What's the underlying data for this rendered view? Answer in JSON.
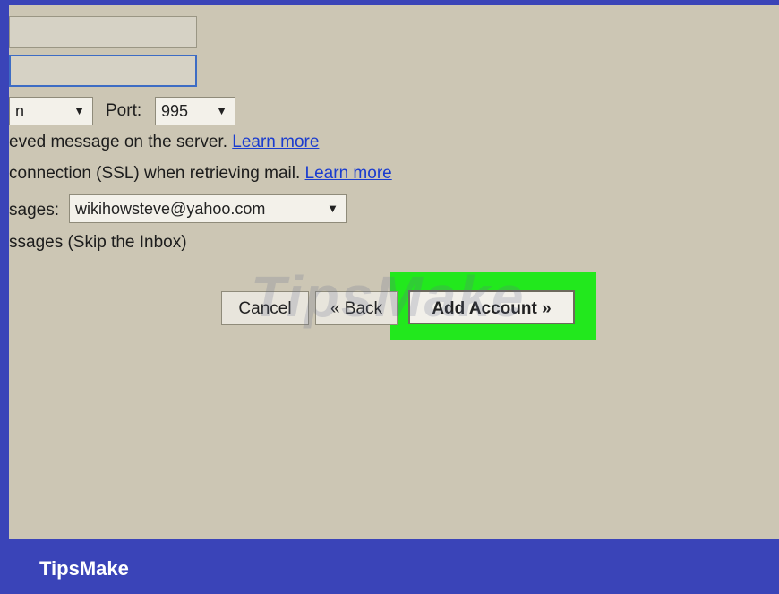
{
  "dialog": {
    "port_label": "Port:",
    "server_select_value": "n",
    "port_select_value": "995",
    "leave_copy_text": "eved message on the server.",
    "ssl_text": "connection (SSL) when retrieving mail.",
    "learn_more": "Learn more",
    "label_as_text": "sages:",
    "label_as_value": "wikihowsteve@yahoo.com",
    "archive_text": "ssages (Skip the Inbox)",
    "buttons": {
      "cancel": "Cancel",
      "back": "« Back",
      "add_account": "Add Account »"
    }
  },
  "icons": {
    "dropdown": "caret-down-icon"
  },
  "colors": {
    "highlight": "#22e81d",
    "frame": "#3a44b8",
    "panel": "#ccc6b4",
    "link": "#1a3ccf"
  },
  "watermark": "TipsMake",
  "footer": {
    "brand": "TipsMake"
  }
}
